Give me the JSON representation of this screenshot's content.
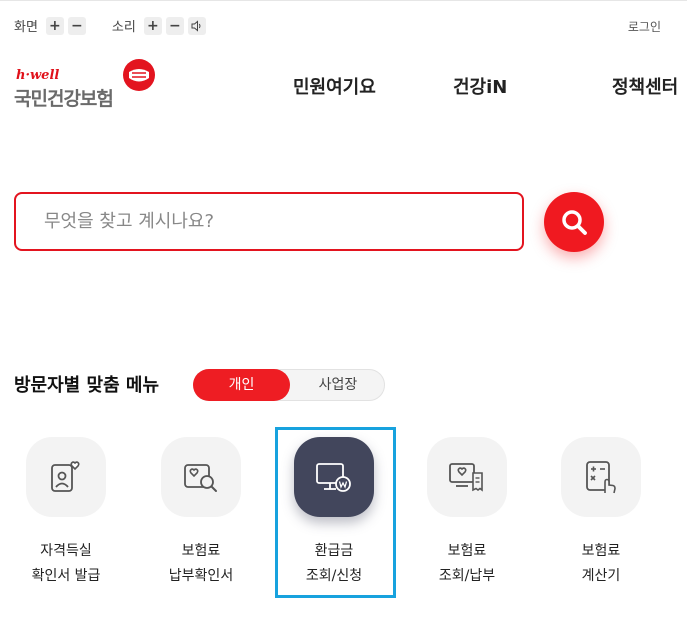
{
  "utility": {
    "screen_label": "화면",
    "sound_label": "소리",
    "plus": "+",
    "minus": "−",
    "login": "로그인"
  },
  "logo": {
    "en": "h·well",
    "ko": "국민건강보험"
  },
  "nav": [
    {
      "label": "민원여기요"
    },
    {
      "label": "건강iN"
    },
    {
      "label": "정책센터"
    }
  ],
  "search": {
    "placeholder": "무엇을 찾고 계시나요?",
    "value": ""
  },
  "visitor_menu": {
    "title": "방문자별 맞춤 메뉴",
    "tabs": [
      {
        "label": "개인",
        "active": true
      },
      {
        "label": "사업장",
        "active": false
      }
    ],
    "items": [
      {
        "line1": "자격득실",
        "line2": "확인서 발급",
        "icon": "id-card-heart-icon"
      },
      {
        "line1": "보험료",
        "line2": "납부확인서",
        "icon": "document-search-icon"
      },
      {
        "line1": "환급금",
        "line2": "조회/신청",
        "icon": "monitor-refund-icon",
        "highlighted": true
      },
      {
        "line1": "보험료",
        "line2": "조회/납부",
        "icon": "monitor-receipt-icon"
      },
      {
        "line1": "보험료",
        "line2": "계산기",
        "icon": "calculator-icon"
      }
    ]
  },
  "colors": {
    "brand_red": "#e3141f",
    "dark_tile": "#42465c",
    "highlight": "#17a2de"
  }
}
